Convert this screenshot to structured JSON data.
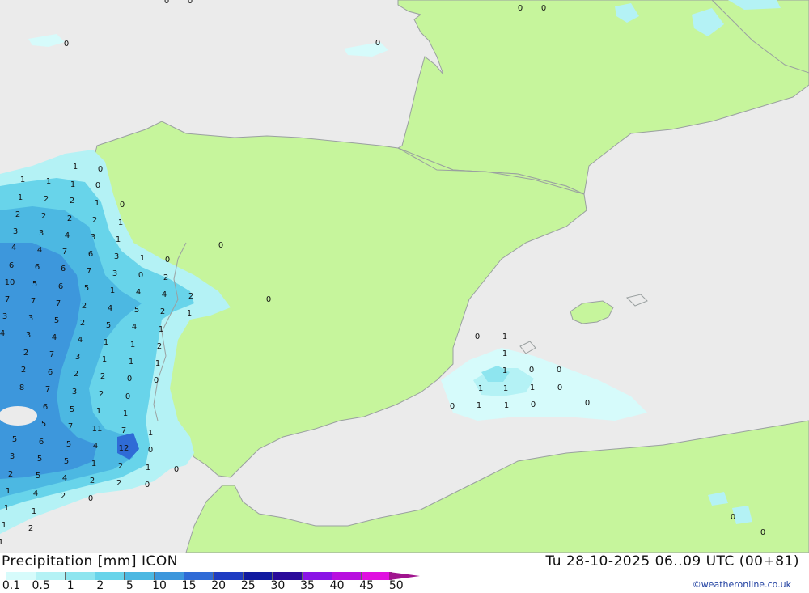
{
  "title": "Precipitation [mm] ICON",
  "valid_time": "Tu 28-10-2025 06..09 UTC (00+81)",
  "credit": "©weatheronline.co.uk",
  "colors": {
    "land": "#c6f59c",
    "sea": "#ebebeb",
    "border": "#9aa0a0"
  },
  "legend": {
    "ticks": [
      "0.1",
      "0.5",
      "1",
      "2",
      "5",
      "10",
      "15",
      "20",
      "25",
      "30",
      "35",
      "40",
      "45",
      "50"
    ],
    "colors": [
      "#d6fbfb",
      "#b4f2f5",
      "#8ee5ef",
      "#68d4ea",
      "#4cb8e2",
      "#3d97dc",
      "#2f6bd6",
      "#1e3cc2",
      "#101aa0",
      "#2a0a9a",
      "#8a14e6",
      "#b80fdf",
      "#e010e0",
      "#c014b4"
    ]
  },
  "values": [
    {
      "v": "0"
    },
    {
      "v": "0"
    },
    {
      "v": "0"
    },
    {
      "v": "0"
    },
    {
      "v": "0"
    },
    {
      "v": "0"
    },
    {
      "v": "1"
    },
    {
      "v": "0"
    },
    {
      "v": "1"
    },
    {
      "v": "1"
    },
    {
      "v": "1"
    },
    {
      "v": "0"
    },
    {
      "v": "1"
    },
    {
      "v": "2"
    },
    {
      "v": "2"
    },
    {
      "v": "1"
    },
    {
      "v": "0"
    },
    {
      "v": "2"
    },
    {
      "v": "2"
    },
    {
      "v": "2"
    },
    {
      "v": "2"
    },
    {
      "v": "1"
    },
    {
      "v": "3"
    },
    {
      "v": "3"
    },
    {
      "v": "4"
    },
    {
      "v": "3"
    },
    {
      "v": "1"
    },
    {
      "v": "4"
    },
    {
      "v": "4"
    },
    {
      "v": "7"
    },
    {
      "v": "6"
    },
    {
      "v": "3"
    },
    {
      "v": "1"
    },
    {
      "v": "0"
    },
    {
      "v": "0"
    },
    {
      "v": "6"
    },
    {
      "v": "6"
    },
    {
      "v": "6"
    },
    {
      "v": "7"
    },
    {
      "v": "3"
    },
    {
      "v": "0"
    },
    {
      "v": "2"
    },
    {
      "v": "10"
    },
    {
      "v": "5"
    },
    {
      "v": "6"
    },
    {
      "v": "5"
    },
    {
      "v": "1"
    },
    {
      "v": "4"
    },
    {
      "v": "4"
    },
    {
      "v": "2"
    },
    {
      "v": "7"
    },
    {
      "v": "7"
    },
    {
      "v": "7"
    },
    {
      "v": "2"
    },
    {
      "v": "4"
    },
    {
      "v": "5"
    },
    {
      "v": "2"
    },
    {
      "v": "1"
    },
    {
      "v": "0"
    },
    {
      "v": "3"
    },
    {
      "v": "3"
    },
    {
      "v": "5"
    },
    {
      "v": "2"
    },
    {
      "v": "5"
    },
    {
      "v": "4"
    },
    {
      "v": "1"
    },
    {
      "v": "4"
    },
    {
      "v": "3"
    },
    {
      "v": "4"
    },
    {
      "v": "4"
    },
    {
      "v": "1"
    },
    {
      "v": "1"
    },
    {
      "v": "2"
    },
    {
      "v": "2"
    },
    {
      "v": "7"
    },
    {
      "v": "3"
    },
    {
      "v": "1"
    },
    {
      "v": "1"
    },
    {
      "v": "1"
    },
    {
      "v": "2"
    },
    {
      "v": "6"
    },
    {
      "v": "2"
    },
    {
      "v": "2"
    },
    {
      "v": "0"
    },
    {
      "v": "0"
    },
    {
      "v": "8"
    },
    {
      "v": "7"
    },
    {
      "v": "3"
    },
    {
      "v": "2"
    },
    {
      "v": "0"
    },
    {
      "v": "6"
    },
    {
      "v": "5"
    },
    {
      "v": "1"
    },
    {
      "v": "1"
    },
    {
      "v": "5"
    },
    {
      "v": "7"
    },
    {
      "v": "11"
    },
    {
      "v": "7"
    },
    {
      "v": "1"
    },
    {
      "v": "5"
    },
    {
      "v": "6"
    },
    {
      "v": "5"
    },
    {
      "v": "4"
    },
    {
      "v": "12"
    },
    {
      "v": "0"
    },
    {
      "v": "3"
    },
    {
      "v": "5"
    },
    {
      "v": "5"
    },
    {
      "v": "1"
    },
    {
      "v": "2"
    },
    {
      "v": "1"
    },
    {
      "v": "0"
    },
    {
      "v": "2"
    },
    {
      "v": "5"
    },
    {
      "v": "4"
    },
    {
      "v": "2"
    },
    {
      "v": "2"
    },
    {
      "v": "0"
    },
    {
      "v": "1"
    },
    {
      "v": "4"
    },
    {
      "v": "2"
    },
    {
      "v": "0"
    },
    {
      "v": "1"
    },
    {
      "v": "1"
    },
    {
      "v": "1"
    },
    {
      "v": "2"
    },
    {
      "v": "1"
    },
    {
      "v": "0"
    },
    {
      "v": "1"
    },
    {
      "v": "1"
    },
    {
      "v": "1"
    },
    {
      "v": "0"
    },
    {
      "v": "0"
    },
    {
      "v": "1"
    },
    {
      "v": "1"
    },
    {
      "v": "1"
    },
    {
      "v": "0"
    },
    {
      "v": "0"
    },
    {
      "v": "1"
    },
    {
      "v": "1"
    },
    {
      "v": "0"
    },
    {
      "v": "0"
    },
    {
      "v": "0"
    },
    {
      "v": "0"
    }
  ]
}
